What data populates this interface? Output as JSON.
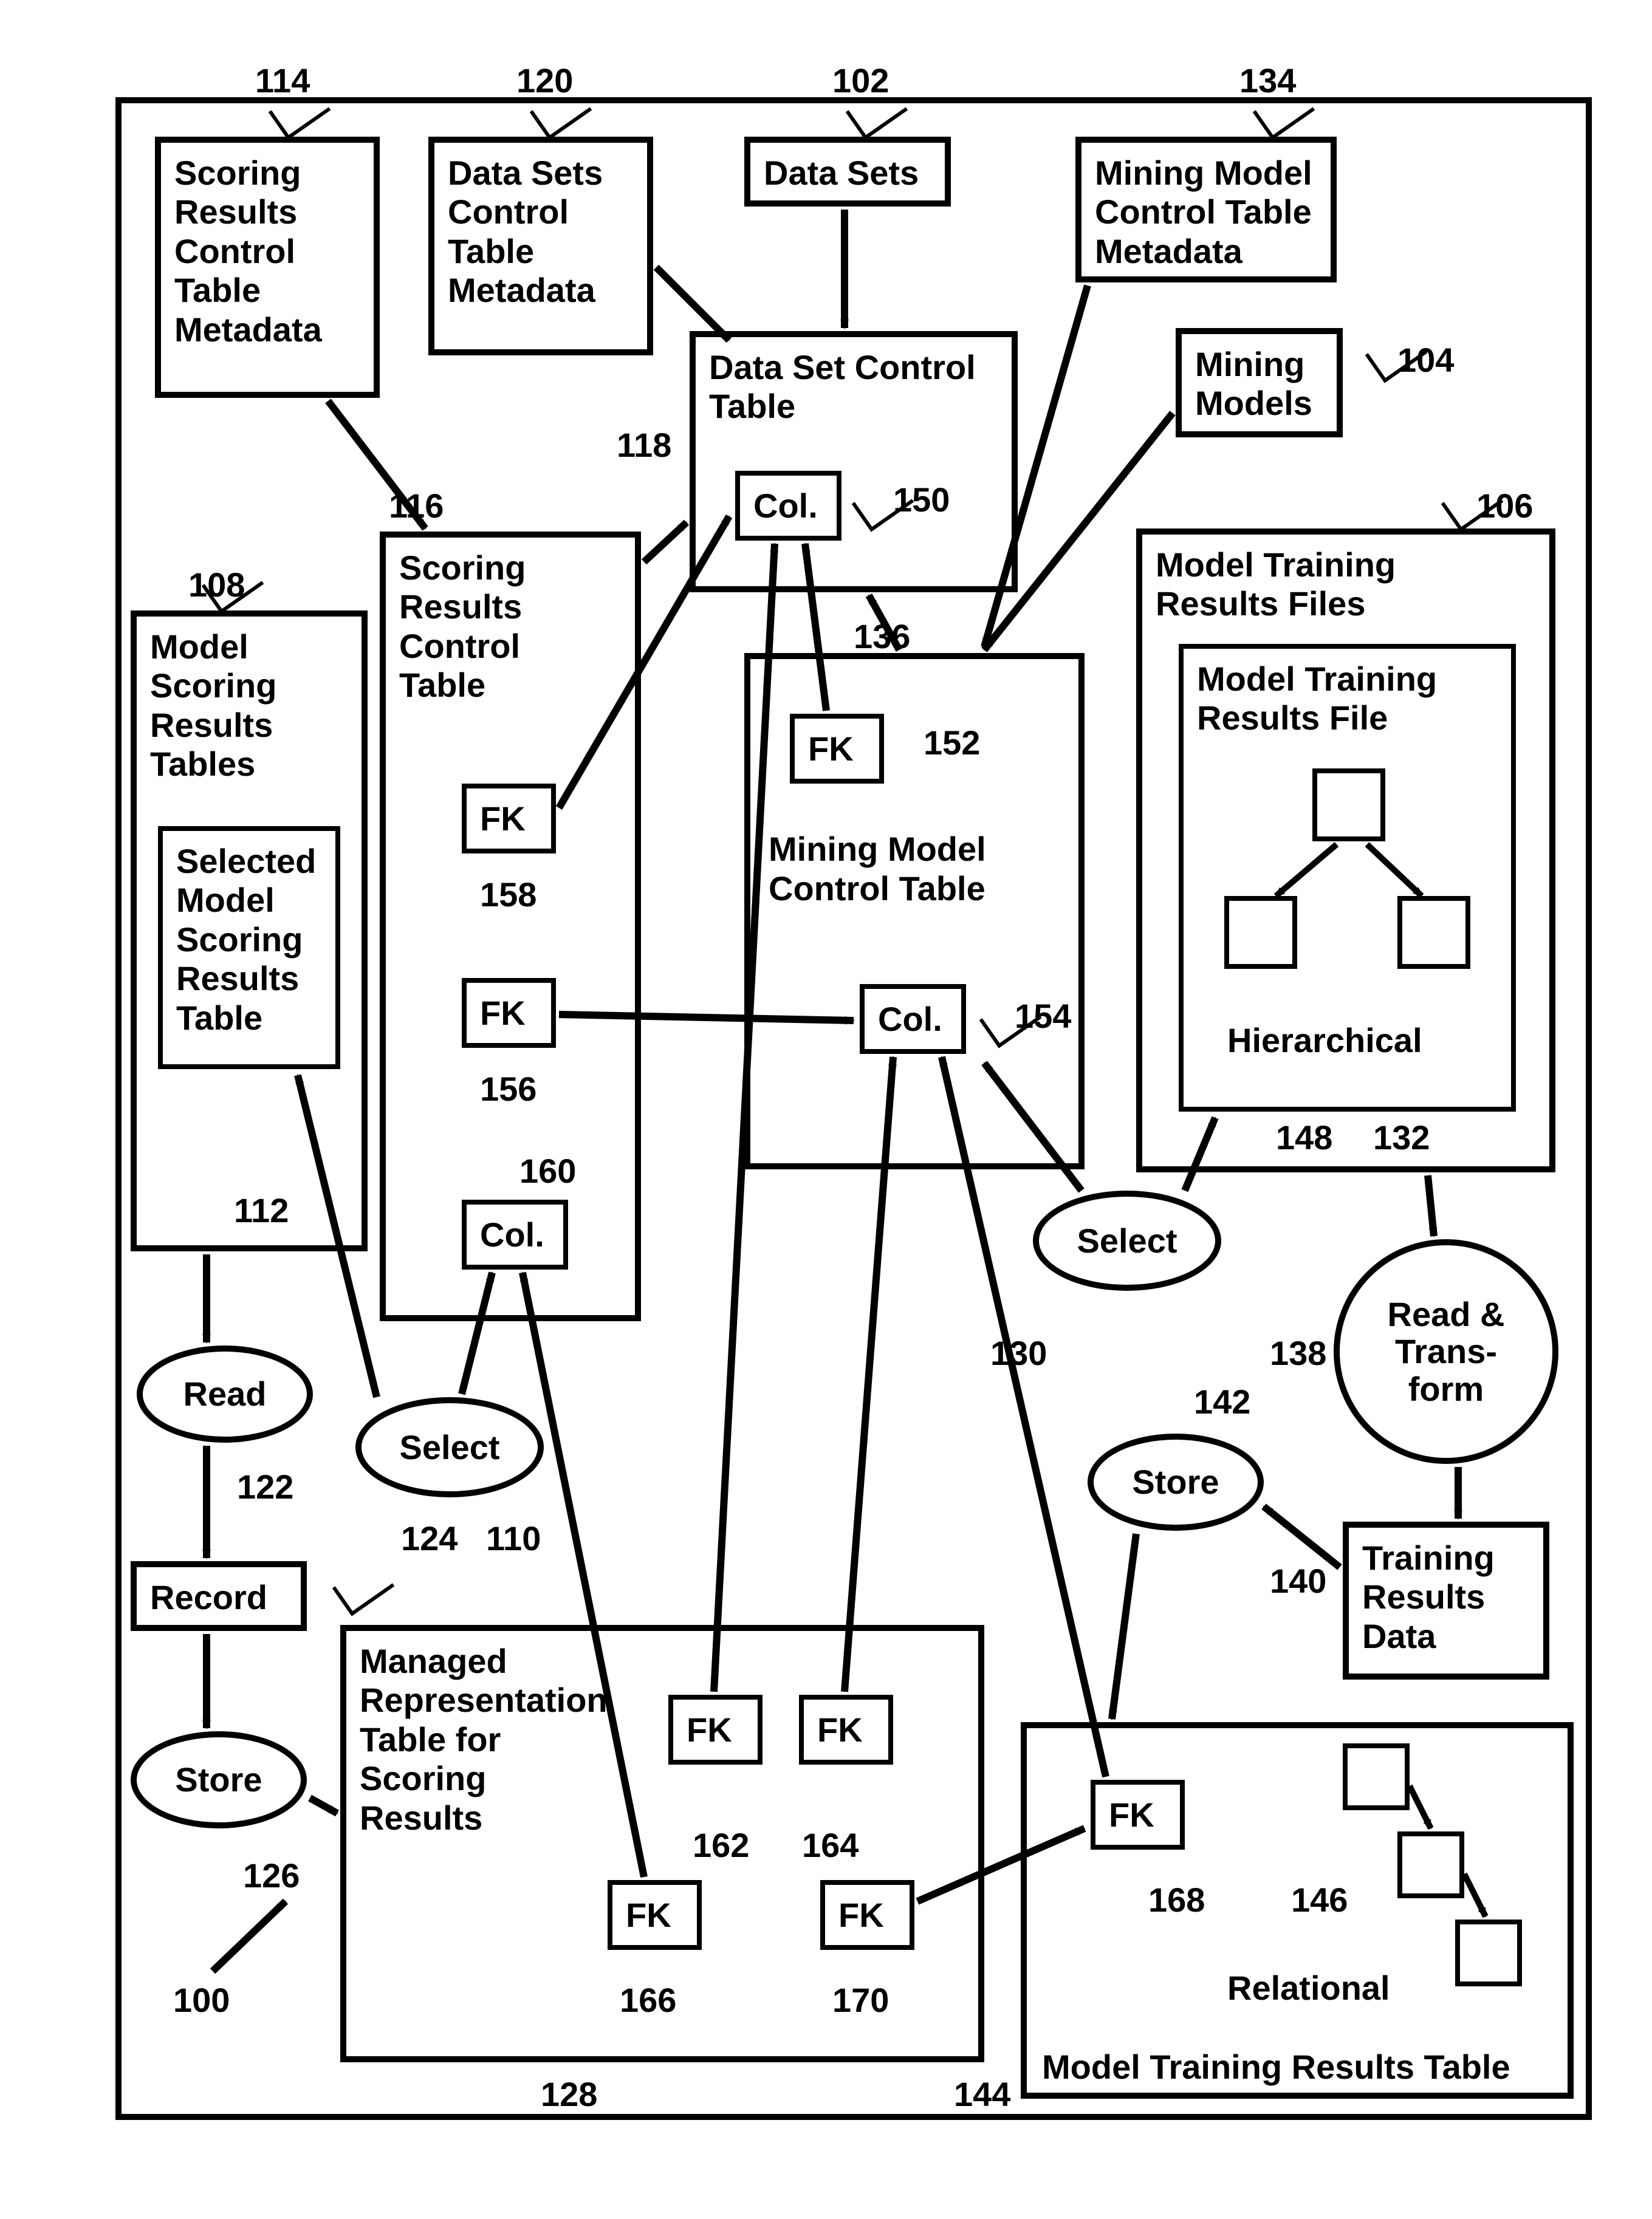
{
  "refs": {
    "r100": "100",
    "r102": "102",
    "r104": "104",
    "r106": "106",
    "r108": "108",
    "r110": "110",
    "r112": "112",
    "r114": "114",
    "r116": "116",
    "r118": "118",
    "r120": "120",
    "r122": "122",
    "r124": "124",
    "r126": "126",
    "r128": "128",
    "r130": "130",
    "r132": "132",
    "r134": "134",
    "r136": "136",
    "r138": "138",
    "r140": "140",
    "r142": "142",
    "r144": "144",
    "r146": "146",
    "r148": "148",
    "r150": "150",
    "r152": "152",
    "r154": "154",
    "r156": "156",
    "r158": "158",
    "r160": "160",
    "r162": "162",
    "r164": "164",
    "r166": "166",
    "r168": "168",
    "r170": "170"
  },
  "boxes": {
    "scoring_results_ctl_meta": "Scoring\nResults\nControl\nTable\nMetadata",
    "data_sets_ctl_meta": "Data Sets\nControl\nTable\nMetadata",
    "data_sets": "Data Sets",
    "mining_model_ctl_meta": "Mining Model\nControl Table\nMetadata",
    "mining_models": "Mining\nModels",
    "data_set_ctl_table": "Data Set Control\nTable",
    "col": "Col.",
    "scoring_results_ctl_table": "Scoring\nResults\nControl\nTable",
    "fk": "FK",
    "model_scoring_results_tables": "Model\nScoring\nResults\nTables",
    "selected_msrt": "Selected\nModel\nScoring\nResults\nTable",
    "mining_model_ctl_table": "Mining Model\nControl Table",
    "model_training_results_files": "Model Training\nResults Files",
    "model_training_results_file": "Model Training\nResults File",
    "hierarchical": "Hierarchical",
    "training_results_data": "Training\nResults\nData",
    "record": "Record",
    "managed_rep_table": "Managed\nRepresentation\nTable for\nScoring\nResults",
    "model_training_results_table": "Model Training Results Table",
    "relational": "Relational"
  },
  "ops": {
    "read": "Read",
    "select": "Select",
    "store": "Store",
    "read_transform": "Read &\nTrans-\nform"
  }
}
